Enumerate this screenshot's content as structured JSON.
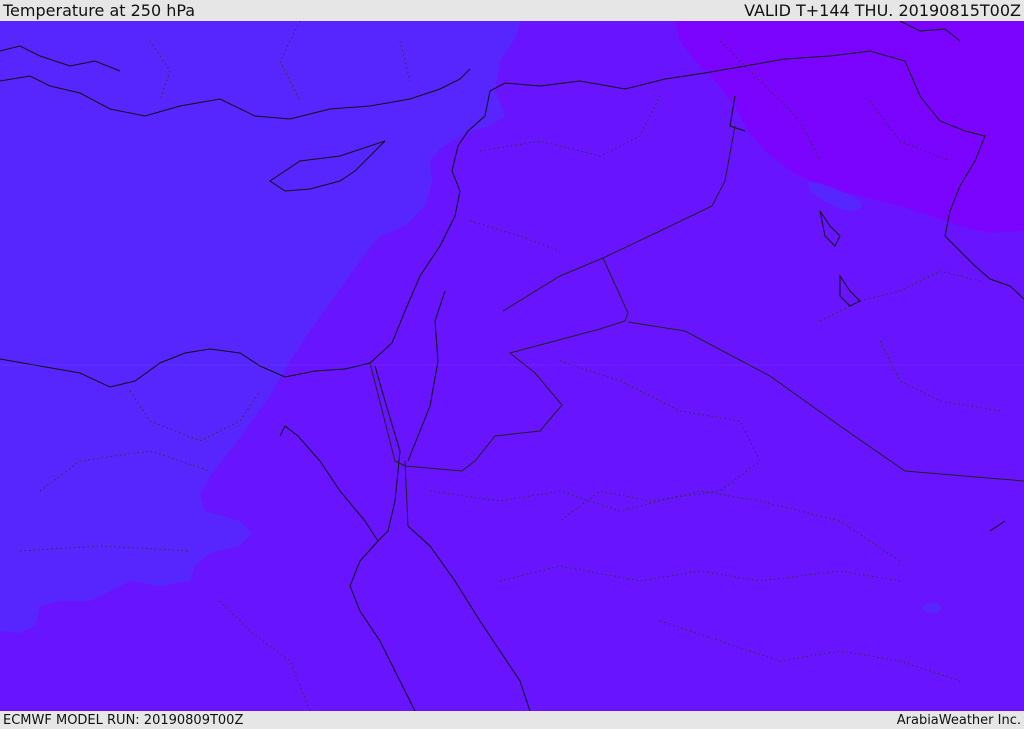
{
  "header": {
    "title": "Temperature at 250 hPa",
    "valid": "VALID T+144 THU. 20190815T00Z"
  },
  "footer": {
    "model_run": "ECMWF MODEL RUN: 20190809T00Z",
    "credit": "ArabiaWeather Inc."
  },
  "colors": {
    "band_cold": "#5726ff",
    "band_mid": "#6814ff",
    "band_warm": "#7a04ff",
    "coast": "#111111",
    "border": "#222222"
  },
  "icons": {
    "map": "map-icon"
  }
}
